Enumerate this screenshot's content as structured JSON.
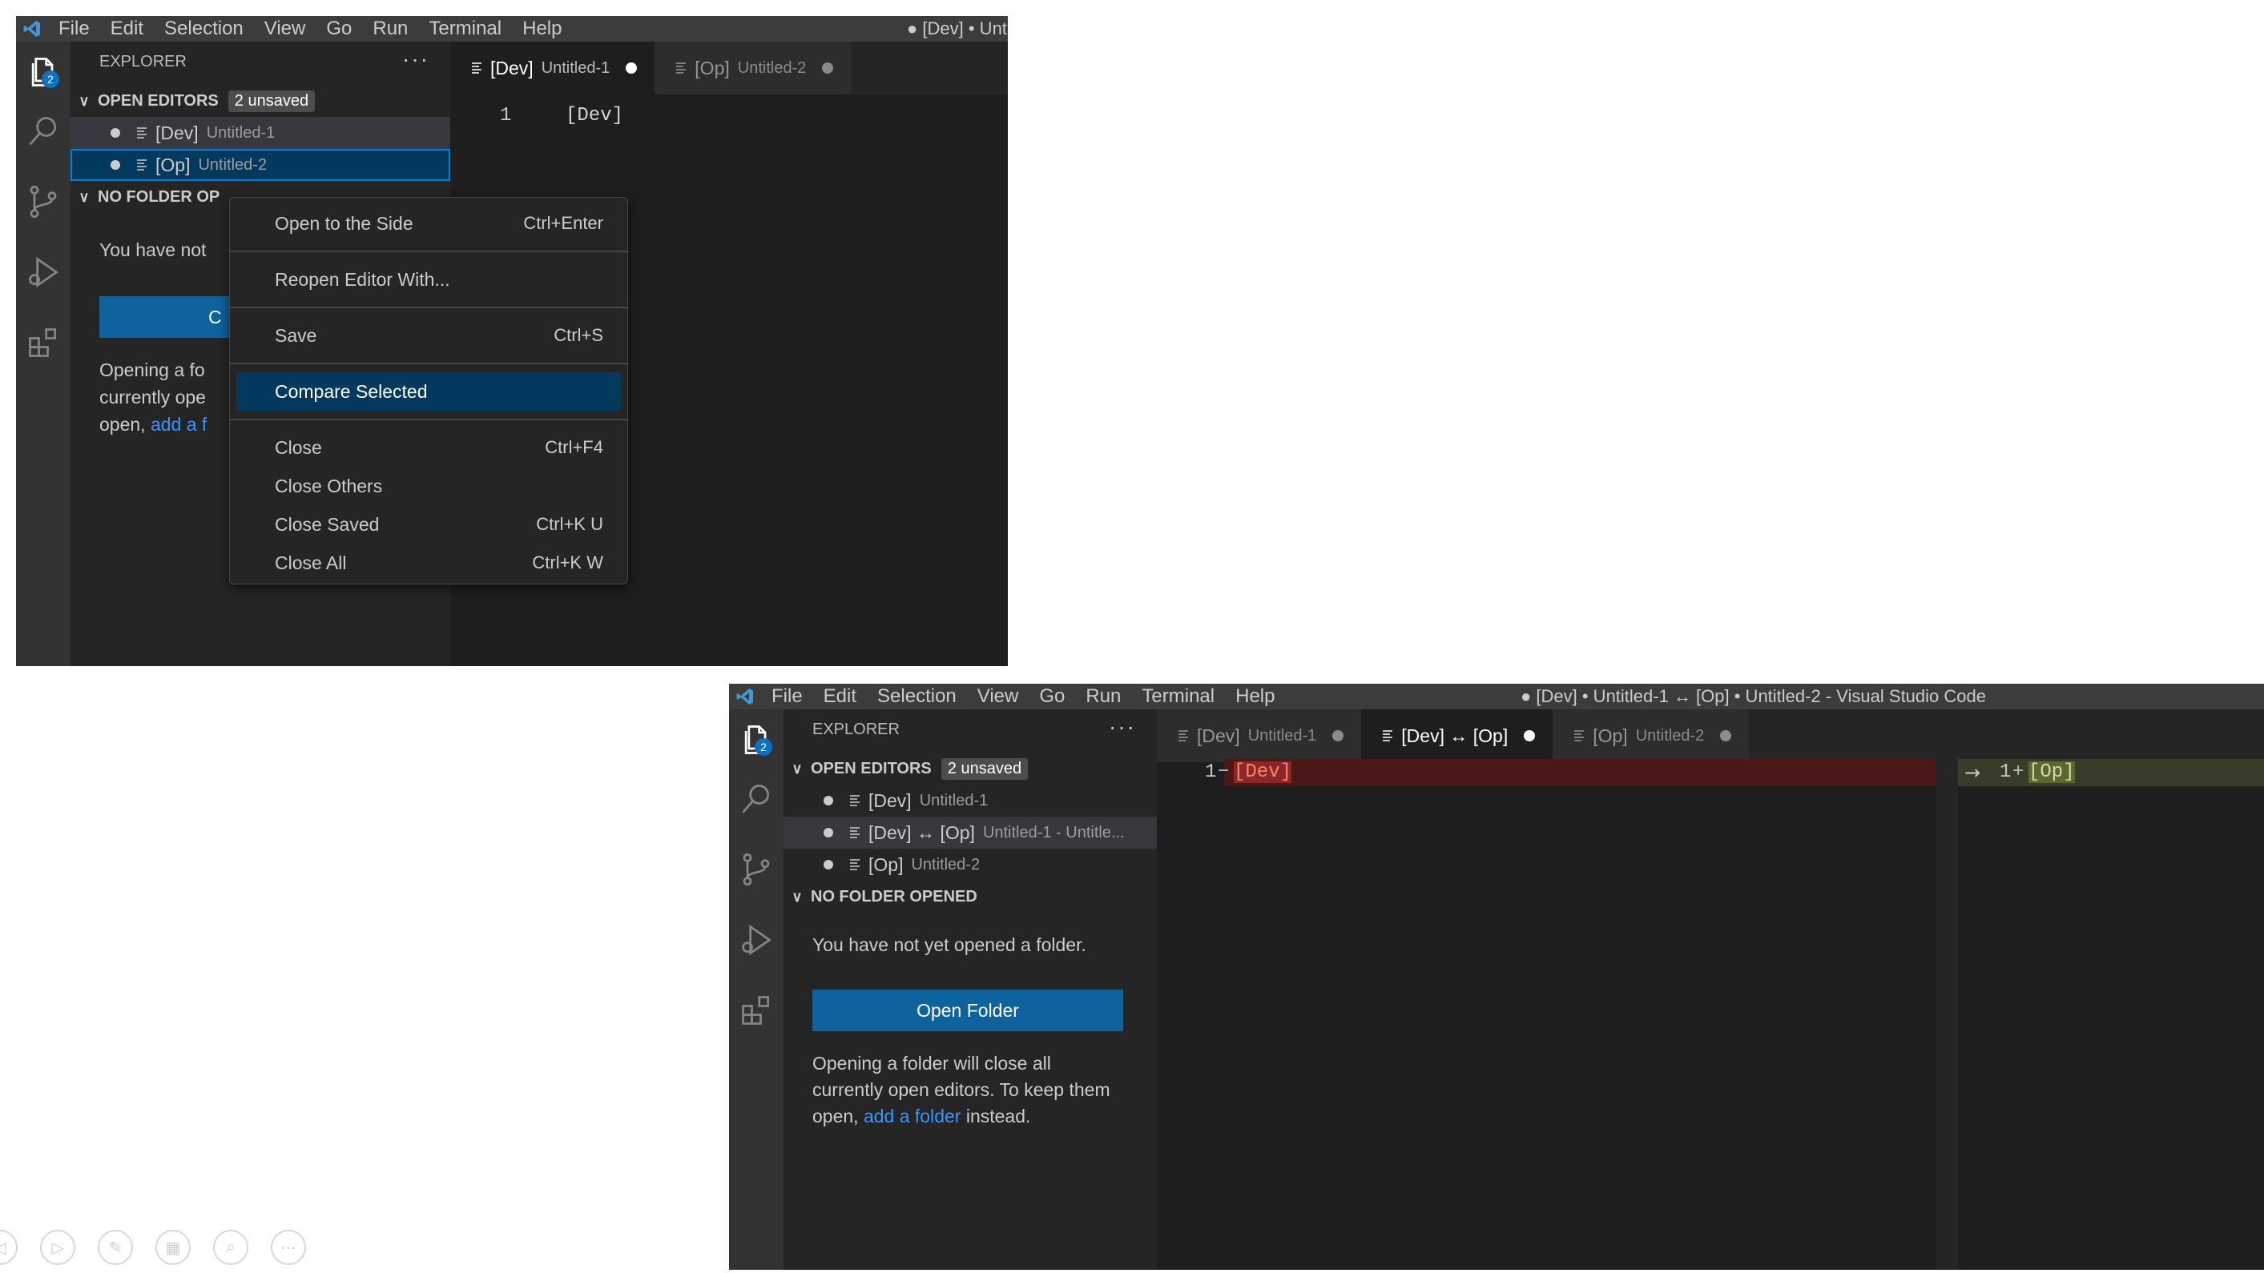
{
  "menu": [
    "File",
    "Edit",
    "Selection",
    "View",
    "Go",
    "Run",
    "Terminal",
    "Help"
  ],
  "win1": {
    "title": "● [Dev] • Unt",
    "explorer_title": "EXPLORER",
    "more": "···",
    "badge": "2",
    "open_editors": {
      "label": "OPEN EDITORS",
      "pill": "2 unsaved"
    },
    "rows": [
      {
        "name": "[Dev]",
        "desc": "Untitled-1"
      },
      {
        "name": "[Op]",
        "desc": "Untitled-2"
      }
    ],
    "no_folder": "NO FOLDER OP",
    "text1": "You have not",
    "button_fragment": "C",
    "para": [
      "Opening a fo",
      "currently ope"
    ],
    "para_open": "open,",
    "link_fragment": "add a f",
    "tabs": [
      {
        "name": "[Dev]",
        "desc": "Untitled-1"
      },
      {
        "name": "[Op]",
        "desc": "Untitled-2"
      }
    ],
    "line_no": "1",
    "code": "[Dev]"
  },
  "context_menu": [
    {
      "label": "Open to the Side",
      "kb": "Ctrl+Enter"
    },
    {
      "label": "Reopen Editor With...",
      "kb": ""
    },
    {
      "label": "Save",
      "kb": "Ctrl+S"
    },
    {
      "label": "Compare Selected",
      "kb": ""
    },
    {
      "label": "Close",
      "kb": "Ctrl+F4"
    },
    {
      "label": "Close Others",
      "kb": ""
    },
    {
      "label": "Close Saved",
      "kb": "Ctrl+K U"
    },
    {
      "label": "Close All",
      "kb": "Ctrl+K W"
    }
  ],
  "win2": {
    "title": "● [Dev] • Untitled-1 ↔ [Op] • Untitled-2 - Visual Studio Code",
    "explorer_title": "EXPLORER",
    "more": "···",
    "badge": "2",
    "open_editors": {
      "label": "OPEN EDITORS",
      "pill": "2 unsaved"
    },
    "rows": [
      {
        "name": "[Dev]",
        "desc": "Untitled-1"
      },
      {
        "name": "[Dev] ↔ [Op]",
        "desc": "Untitled-1 - Untitle..."
      },
      {
        "name": "[Op]",
        "desc": "Untitled-2"
      }
    ],
    "no_folder": "NO FOLDER OPENED",
    "text1": "You have not yet opened a folder.",
    "button": "Open Folder",
    "para": [
      "Opening a folder will close all",
      "currently open editors. To keep them"
    ],
    "para_open": "open,",
    "link": "add a folder",
    "para_end": "instead.",
    "tabs": [
      {
        "name": "[Dev]",
        "desc": "Untitled-1"
      },
      {
        "name": "[Dev] ↔ [Op]",
        "desc": ""
      },
      {
        "name": "[Op]",
        "desc": "Untitled-2"
      }
    ],
    "left_line": "1",
    "left_marker": "−",
    "left_code": "[Dev]",
    "arrow": "→",
    "right_line": "1",
    "right_marker": "+",
    "right_code": "[Op]"
  },
  "colors": {
    "accent": "#0e639c",
    "badge": "#0e70c0",
    "link": "#3794ff",
    "selection": "#04395e"
  },
  "slideshow_icons": [
    "back-icon",
    "play-icon",
    "pen-icon",
    "slides-icon",
    "zoom-icon",
    "more-icon"
  ]
}
